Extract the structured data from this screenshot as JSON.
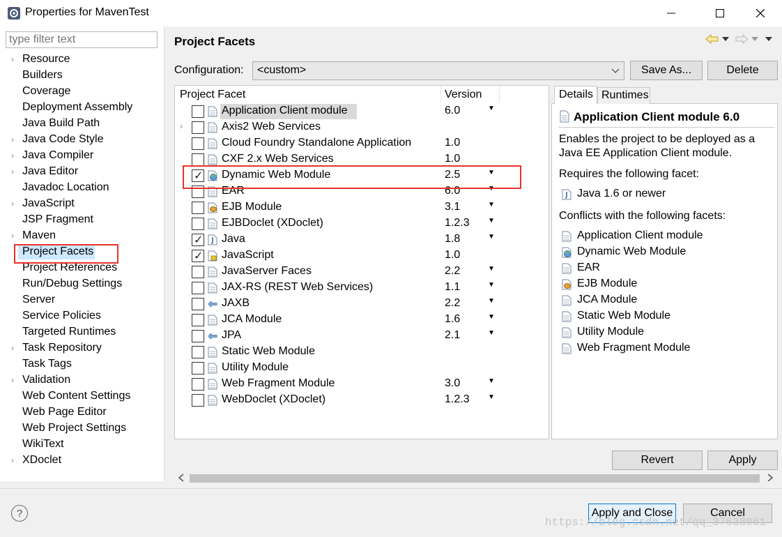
{
  "window": {
    "title": "Properties for MavenTest",
    "minimize": "—",
    "maximize": "☐",
    "close": "✕"
  },
  "filter": {
    "placeholder": "type filter text"
  },
  "nav": {
    "items": [
      {
        "label": "Resource",
        "expandable": true
      },
      {
        "label": "Builders",
        "expandable": false
      },
      {
        "label": "Coverage",
        "expandable": false
      },
      {
        "label": "Deployment Assembly",
        "expandable": false
      },
      {
        "label": "Java Build Path",
        "expandable": false
      },
      {
        "label": "Java Code Style",
        "expandable": true
      },
      {
        "label": "Java Compiler",
        "expandable": true
      },
      {
        "label": "Java Editor",
        "expandable": true
      },
      {
        "label": "Javadoc Location",
        "expandable": false
      },
      {
        "label": "JavaScript",
        "expandable": true
      },
      {
        "label": "JSP Fragment",
        "expandable": false
      },
      {
        "label": "Maven",
        "expandable": true
      },
      {
        "label": "Project Facets",
        "expandable": false,
        "selected": true
      },
      {
        "label": "Project References",
        "expandable": false
      },
      {
        "label": "Run/Debug Settings",
        "expandable": false
      },
      {
        "label": "Server",
        "expandable": false
      },
      {
        "label": "Service Policies",
        "expandable": false
      },
      {
        "label": "Targeted Runtimes",
        "expandable": false
      },
      {
        "label": "Task Repository",
        "expandable": true
      },
      {
        "label": "Task Tags",
        "expandable": false
      },
      {
        "label": "Validation",
        "expandable": true
      },
      {
        "label": "Web Content Settings",
        "expandable": false
      },
      {
        "label": "Web Page Editor",
        "expandable": false
      },
      {
        "label": "Web Project Settings",
        "expandable": false
      },
      {
        "label": "WikiText",
        "expandable": false
      },
      {
        "label": "XDoclet",
        "expandable": true
      }
    ]
  },
  "page": {
    "title": "Project Facets",
    "config_label": "Configuration:",
    "config_value": "<custom>",
    "save_as": "Save As...",
    "delete": "Delete"
  },
  "facets": {
    "col_facet": "Project Facet",
    "col_version": "Version",
    "rows": [
      {
        "name": "Application Client module",
        "version": "6.0",
        "checked": false,
        "dropdown": true,
        "icon": "page",
        "expandable": false
      },
      {
        "name": "Axis2 Web Services",
        "version": "",
        "checked": false,
        "dropdown": false,
        "icon": "page",
        "expandable": true
      },
      {
        "name": "Cloud Foundry Standalone Application",
        "version": "1.0",
        "checked": false,
        "dropdown": false,
        "icon": "page",
        "expandable": false
      },
      {
        "name": "CXF 2.x Web Services",
        "version": "1.0",
        "checked": false,
        "dropdown": false,
        "icon": "page",
        "expandable": false
      },
      {
        "name": "Dynamic Web Module",
        "version": "2.5",
        "checked": true,
        "dropdown": true,
        "icon": "globe",
        "expandable": false
      },
      {
        "name": "EAR",
        "version": "6.0",
        "checked": false,
        "dropdown": true,
        "icon": "page",
        "expandable": false
      },
      {
        "name": "EJB Module",
        "version": "3.1",
        "checked": false,
        "dropdown": true,
        "icon": "bean",
        "expandable": false
      },
      {
        "name": "EJBDoclet (XDoclet)",
        "version": "1.2.3",
        "checked": false,
        "dropdown": true,
        "icon": "page",
        "expandable": false
      },
      {
        "name": "Java",
        "version": "1.8",
        "checked": true,
        "dropdown": true,
        "icon": "java",
        "expandable": false
      },
      {
        "name": "JavaScript",
        "version": "1.0",
        "checked": true,
        "dropdown": false,
        "icon": "js",
        "expandable": false
      },
      {
        "name": "JavaServer Faces",
        "version": "2.2",
        "checked": false,
        "dropdown": true,
        "icon": "page",
        "expandable": false
      },
      {
        "name": "JAX-RS (REST Web Services)",
        "version": "1.1",
        "checked": false,
        "dropdown": true,
        "icon": "page",
        "expandable": false
      },
      {
        "name": "JAXB",
        "version": "2.2",
        "checked": false,
        "dropdown": true,
        "icon": "arrows",
        "expandable": false
      },
      {
        "name": "JCA Module",
        "version": "1.6",
        "checked": false,
        "dropdown": true,
        "icon": "page",
        "expandable": false
      },
      {
        "name": "JPA",
        "version": "2.1",
        "checked": false,
        "dropdown": true,
        "icon": "arrows",
        "expandable": false
      },
      {
        "name": "Static Web Module",
        "version": "",
        "checked": false,
        "dropdown": false,
        "icon": "page",
        "expandable": false
      },
      {
        "name": "Utility Module",
        "version": "",
        "checked": false,
        "dropdown": false,
        "icon": "page",
        "expandable": false
      },
      {
        "name": "Web Fragment Module",
        "version": "3.0",
        "checked": false,
        "dropdown": true,
        "icon": "page",
        "expandable": false
      },
      {
        "name": "WebDoclet (XDoclet)",
        "version": "1.2.3",
        "checked": false,
        "dropdown": true,
        "icon": "page",
        "expandable": false
      }
    ]
  },
  "details": {
    "tab_details": "Details",
    "tab_runtimes": "Runtimes",
    "title": "Application Client module 6.0",
    "desc_line1": "Enables the project to be deployed as a",
    "desc_line2": "Java EE Application Client module.",
    "requires_label": "Requires the following facet:",
    "requires": [
      {
        "label": "Java 1.6 or newer",
        "icon": "java"
      }
    ],
    "conflicts_label": "Conflicts with the following facets:",
    "conflicts": [
      {
        "label": "Application Client module",
        "icon": "page"
      },
      {
        "label": "Dynamic Web Module",
        "icon": "globe"
      },
      {
        "label": "EAR",
        "icon": "page"
      },
      {
        "label": "EJB Module",
        "icon": "bean"
      },
      {
        "label": "JCA Module",
        "icon": "page"
      },
      {
        "label": "Static Web Module",
        "icon": "page"
      },
      {
        "label": "Utility Module",
        "icon": "page"
      },
      {
        "label": "Web Fragment Module",
        "icon": "page"
      }
    ]
  },
  "buttons": {
    "revert": "Revert",
    "apply": "Apply",
    "apply_close": "Apply and Close",
    "cancel": "Cancel"
  },
  "watermark": "https://blog.csdn.net/qq_37638061",
  "colors": {
    "highlight_red": "#e8332a",
    "selection_blue": "#cde8ff",
    "accent_blue": "#0078d7"
  }
}
